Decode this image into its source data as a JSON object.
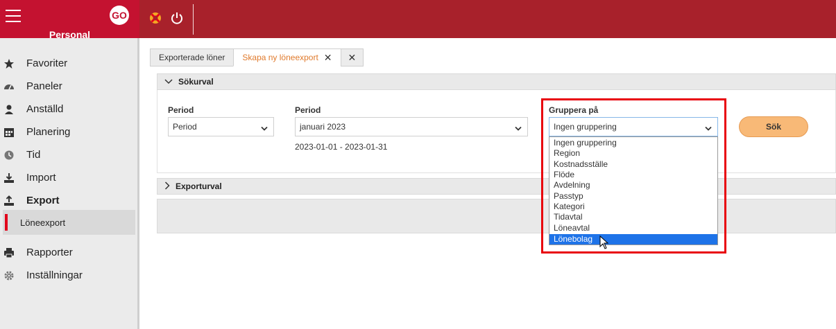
{
  "app": {
    "brand_title": "Personal",
    "logo_text": "GO",
    "brand_color": "#c41230",
    "header_color": "#a8212b"
  },
  "header": {
    "icons": [
      "lifebuoy-icon",
      "power-icon"
    ]
  },
  "sidebar": {
    "items": [
      {
        "label": "Favoriter",
        "icon": "star-icon"
      },
      {
        "label": "Paneler",
        "icon": "gauge-icon"
      },
      {
        "label": "Anställd",
        "icon": "person-icon"
      },
      {
        "label": "Planering",
        "icon": "calendar-icon"
      },
      {
        "label": "Tid",
        "icon": "clock-icon"
      },
      {
        "label": "Import",
        "icon": "download-icon"
      },
      {
        "label": "Export",
        "icon": "upload-icon"
      },
      {
        "label": "Rapporter",
        "icon": "printer-icon"
      },
      {
        "label": "Inställningar",
        "icon": "gear-icon"
      }
    ],
    "sub_item": {
      "label": "Löneexport"
    }
  },
  "tabs": [
    {
      "label": "Exporterade löner"
    },
    {
      "label": "Skapa ny löneexport",
      "close": "✕"
    },
    {
      "label": "✕"
    }
  ],
  "search_section": {
    "title": "Sökurval",
    "period_type": {
      "label": "Period",
      "value": "Period"
    },
    "period": {
      "label": "Period",
      "value": "januari 2023",
      "range": "2023-01-01 - 2023-01-31"
    },
    "grouping": {
      "label": "Gruppera på",
      "value": "Ingen gruppering",
      "options": [
        "Ingen gruppering",
        "Region",
        "Kostnadsställe",
        "Flöde",
        "Avdelning",
        "Passtyp",
        "Kategori",
        "Tidavtal",
        "Löneavtal",
        "Lönebolag"
      ],
      "highlighted_option": "Lönebolag"
    },
    "search_button": "Sök"
  },
  "export_section": {
    "title": "Exporturval"
  },
  "colors": {
    "accent_orange": "#f8b977",
    "active_tab_text": "#e07a2c",
    "highlight_red": "#e8000b",
    "selected_option": "#1e73e8"
  }
}
